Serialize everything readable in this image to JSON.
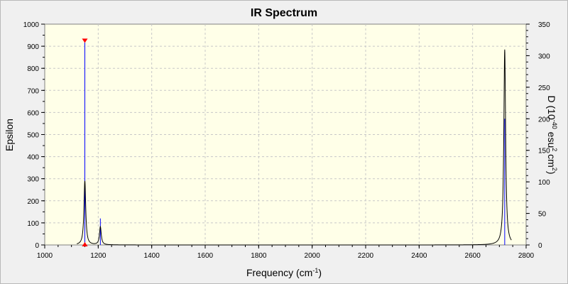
{
  "window": {
    "title": "IR Spectrum"
  },
  "chart_data": {
    "type": "line",
    "title": "IR Spectrum",
    "xlabel": "Frequency",
    "xlabel_unit": "(cm",
    "xlabel_unit_sup": "-1",
    "xlabel_unit_end": ")",
    "ylabel_left": "Epsilon",
    "ylabel_right": "D (10",
    "ylabel_right_parts": [
      "D (10",
      "-40",
      " esu",
      "2",
      " cm",
      "2",
      ")"
    ],
    "xlim": [
      1000,
      2800
    ],
    "ylim_left": [
      0,
      1000
    ],
    "ylim_right": [
      0,
      350
    ],
    "x_ticks": [
      1000,
      1200,
      1400,
      1600,
      1800,
      2000,
      2200,
      2400,
      2600,
      2800
    ],
    "y_ticks_left": [
      0,
      100,
      200,
      300,
      400,
      500,
      600,
      700,
      800,
      900,
      1000
    ],
    "y_ticks_right": [
      0,
      50,
      100,
      150,
      200,
      250,
      300,
      350
    ],
    "grid": true,
    "background_color": "#ffffe8",
    "spectrum_color": "#000000",
    "stick_color": "#0000ff",
    "marker_color": "#ff0000",
    "series": [
      {
        "kind": "spectrum",
        "axis": "left",
        "peaks": [
          {
            "center": 1150,
            "height": 290,
            "hwhm": 4
          },
          {
            "center": 1208,
            "height": 82,
            "hwhm": 4
          },
          {
            "center": 2720,
            "height": 885,
            "hwhm": 4
          }
        ]
      },
      {
        "kind": "sticks",
        "axis": "right",
        "x": [
          1150,
          1208,
          2720
        ],
        "values": [
          323,
          42,
          200
        ]
      }
    ],
    "marker": {
      "x": 1150,
      "top_value": 925
    }
  }
}
